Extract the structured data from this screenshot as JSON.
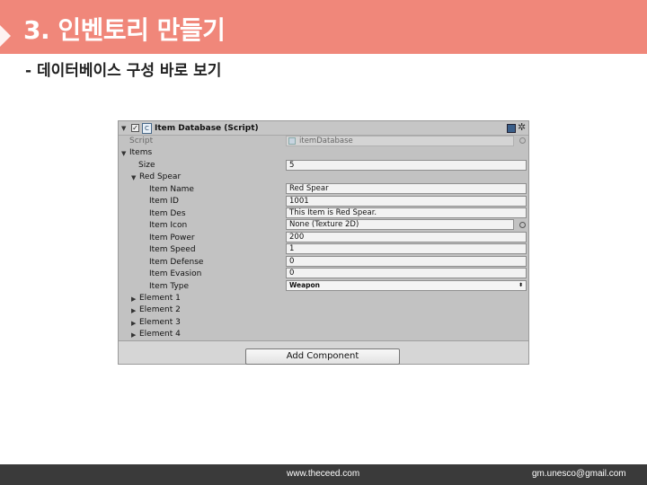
{
  "slide": {
    "title": "3. 인벤토리 만들기",
    "subtitle": "- 데이터베이스 구성 바로 보기"
  },
  "colors": {
    "title_bar": "#f0877a",
    "footer_bar": "#3a3a3a"
  },
  "inspector": {
    "component_title": "Item Database (Script)",
    "checkbox_mark": "✓",
    "script_label": "Script",
    "script_value": "itemDatabase",
    "items_label": "Items",
    "size_label": "Size",
    "size_value": "5",
    "element0_label": "Red Spear",
    "fields": {
      "item_name": {
        "label": "Item Name",
        "value": "Red Spear"
      },
      "item_id": {
        "label": "Item ID",
        "value": "1001"
      },
      "item_des": {
        "label": "Item Des",
        "value": "This Item is Red Spear."
      },
      "item_icon": {
        "label": "Item Icon",
        "value": "None (Texture 2D)"
      },
      "item_power": {
        "label": "Item Power",
        "value": "200"
      },
      "item_speed": {
        "label": "Item Speed",
        "value": "1"
      },
      "item_defense": {
        "label": "Item Defense",
        "value": "0"
      },
      "item_evasion": {
        "label": "Item Evasion",
        "value": "0"
      },
      "item_type": {
        "label": "Item Type",
        "value": "Weapon"
      }
    },
    "collapsed_elements": [
      "Element 1",
      "Element 2",
      "Element 3",
      "Element 4"
    ],
    "add_component_label": "Add Component",
    "icons": {
      "foldout_open": "▼",
      "foldout_closed": "▶",
      "gear": "✲",
      "script": "C",
      "dropdown": "⬍"
    }
  },
  "footer": {
    "website": "www.theceed.com",
    "email": "gm.unesco@gmail.com"
  }
}
